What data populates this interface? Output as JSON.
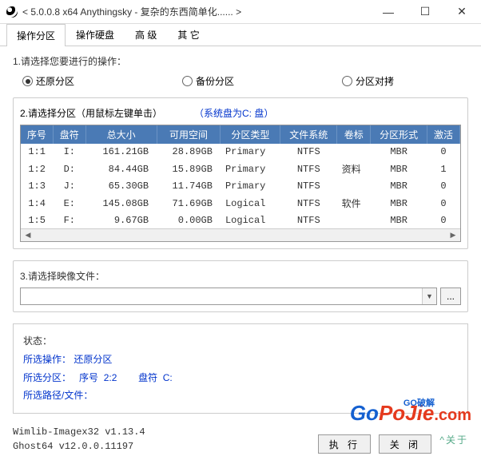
{
  "title": "< 5.0.0.8 x64 Anythingsky - 复杂的东西简单化...... >",
  "tabs": [
    "操作分区",
    "操作硬盘",
    "高 级",
    "其 它"
  ],
  "section1": {
    "label": "1.请选择您要进行的操作：",
    "options": [
      "还原分区",
      "备份分区",
      "分区对拷"
    ],
    "selected": 0
  },
  "section2": {
    "label": "2.请选择分区（用鼠标左键单击）",
    "sysdisk": "（系统盘为C: 盘）",
    "columns": [
      "序号",
      "盘符",
      "总大小",
      "可用空间",
      "分区类型",
      "文件系统",
      "卷标",
      "分区形式",
      "激活"
    ],
    "rows": [
      {
        "seq": "1:1",
        "drv": "I:",
        "size": "161.21GB",
        "free": "28.89GB",
        "ptype": "Primary",
        "fs": "NTFS",
        "label": "",
        "scheme": "MBR",
        "active": "0"
      },
      {
        "seq": "1:2",
        "drv": "D:",
        "size": "84.44GB",
        "free": "15.89GB",
        "ptype": "Primary",
        "fs": "NTFS",
        "label": "资料",
        "scheme": "MBR",
        "active": "1"
      },
      {
        "seq": "1:3",
        "drv": "J:",
        "size": "65.30GB",
        "free": "11.74GB",
        "ptype": "Primary",
        "fs": "NTFS",
        "label": "",
        "scheme": "MBR",
        "active": "0"
      },
      {
        "seq": "1:4",
        "drv": "E:",
        "size": "145.08GB",
        "free": "71.69GB",
        "ptype": "Logical",
        "fs": "NTFS",
        "label": "软件",
        "scheme": "MBR",
        "active": "0"
      },
      {
        "seq": "1:5",
        "drv": "F:",
        "size": "9.67GB",
        "free": "0.00GB",
        "ptype": "Logical",
        "fs": "NTFS",
        "label": "",
        "scheme": "MBR",
        "active": "0"
      }
    ]
  },
  "section3": {
    "label": "3.请选择映像文件：",
    "browse": "..."
  },
  "status": {
    "header": "状态：",
    "op_k": "所选操作：",
    "op_v": "还原分区",
    "part_k": "所选分区：",
    "seq_k": "序号",
    "seq_v": "2:2",
    "drv_k": "盘符",
    "drv_v": "C:",
    "path_k": "所选路径/文件："
  },
  "versions": {
    "line1": "Wimlib-Imagex32 v1.13.4",
    "line2": "Ghost64 v12.0.0.11197"
  },
  "buttons": {
    "exec": "执 行",
    "close": "关 闭",
    "about": "^关于"
  },
  "watermark": {
    "go": "Go",
    "po": "PoJie",
    "com": ".com",
    "sub": "GO破解"
  }
}
